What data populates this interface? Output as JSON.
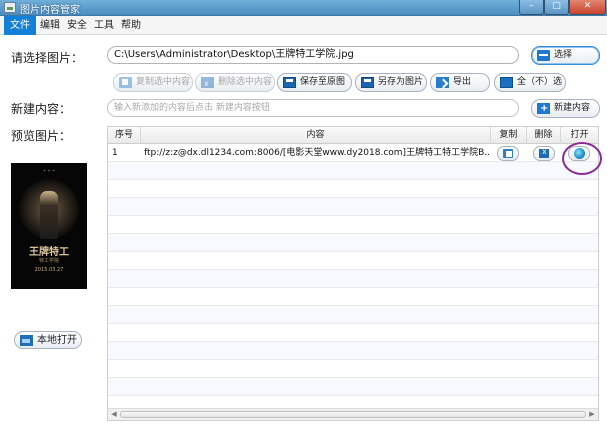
{
  "window": {
    "title": "图片内容管家",
    "controls": {
      "minimize": "–",
      "maximize": "□",
      "close": "✕"
    }
  },
  "menu": {
    "items": [
      {
        "label": "文件",
        "active": true
      },
      {
        "label": "编辑",
        "active": false
      },
      {
        "label": "安全",
        "active": false
      },
      {
        "label": "工具",
        "active": false
      },
      {
        "label": "帮助",
        "active": false
      }
    ]
  },
  "form": {
    "select_image_label": "请选择图片：",
    "image_path_value": "C:\\Users\\Administrator\\Desktop\\王牌特工学院.jpg",
    "select_button": "选择",
    "new_content_label": "新建内容：",
    "new_content_placeholder": "输入新添加的内容后点击 新建内容按钮",
    "new_content_button": "新建内容",
    "preview_label": "预览图片："
  },
  "toolbar": {
    "copy_selected": "复制选中内容",
    "delete_selected": "删除选中内容",
    "save_to_original": "保存至原图",
    "save_as_image": "另存为图片",
    "export": "导出",
    "select_all": "全（不）选"
  },
  "table": {
    "columns": [
      "序号",
      "内容",
      "复制",
      "删除",
      "打开"
    ],
    "rows": [
      {
        "index": "1",
        "content": "ftp://z:z@dx.dl1234.com:8006/[电影天堂www.dy2018.com]王牌特工特工学院B..."
      }
    ],
    "empty_rows": 14
  },
  "preview": {
    "poster_title": "王牌特工",
    "poster_subtitle": "特工学院",
    "poster_date": "2015.03.27"
  },
  "local_open_button": "本地打开",
  "colors": {
    "accent": "#1580d8",
    "highlight_circle": "#8a2c94"
  }
}
